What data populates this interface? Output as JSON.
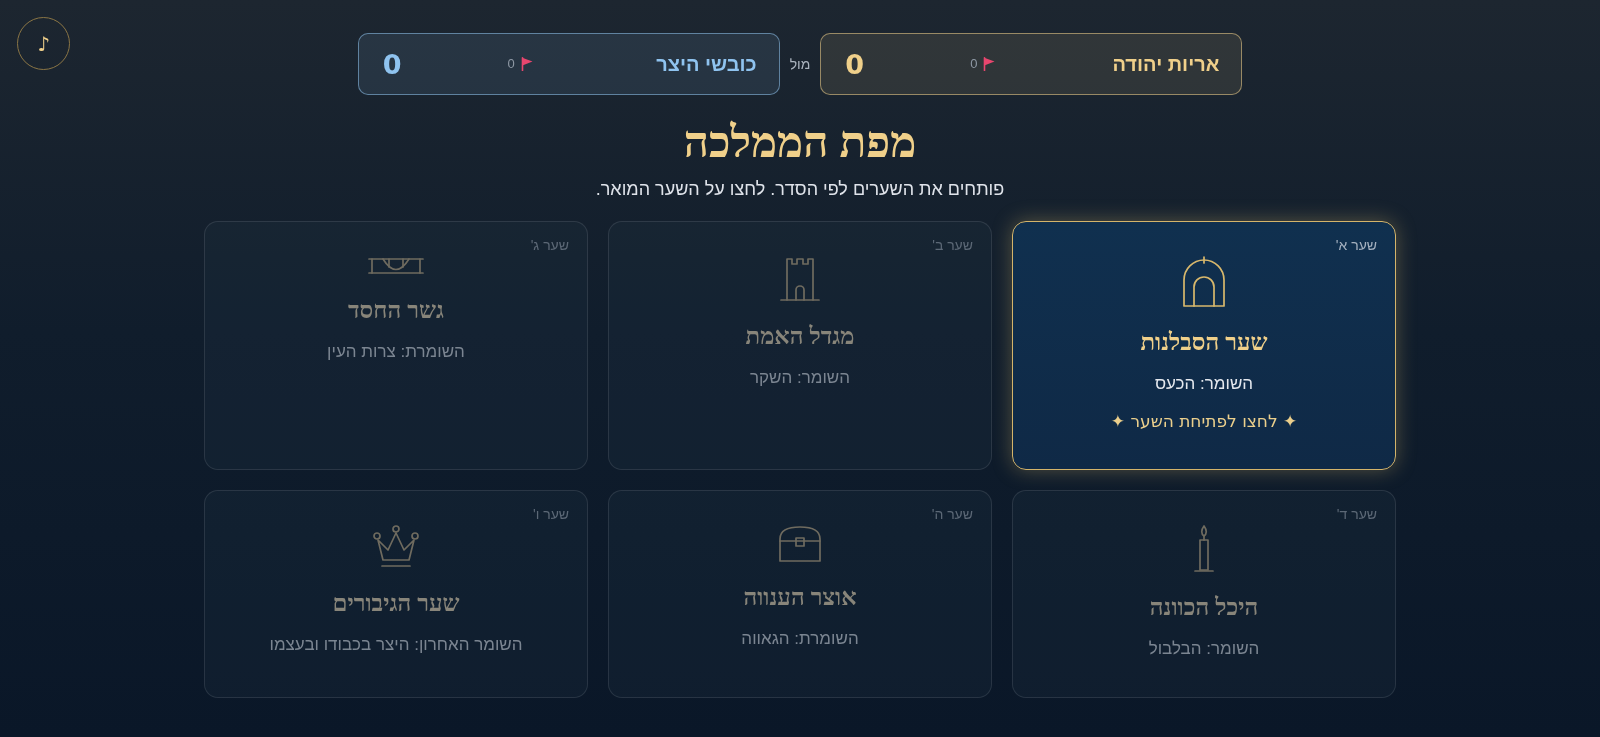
{
  "music_button": {
    "label": "♪"
  },
  "scoreboard": {
    "teams": [
      {
        "name": "אריות יהודה",
        "flags": "0",
        "score": "0",
        "color": "#f0d08a"
      },
      {
        "name": "כובשי היצר",
        "flags": "0",
        "score": "0",
        "color": "#8fc3ef"
      }
    ],
    "versus": "מול"
  },
  "title": "מפת הממלכה",
  "subtitle": "פותחים את השערים לפי הסדר. לחצו על השער המואר.",
  "gates": [
    {
      "number": "שער א'",
      "kind": "arch",
      "name": "שער הסבלנות",
      "guardian": "השומר: הכעס",
      "hint": "✦ לחצו לפתיחת השער ✦",
      "locked": false
    },
    {
      "number": "שער ב'",
      "kind": "tower",
      "name": "מגדל האמת",
      "guardian": "השומר: השקר",
      "locked": true
    },
    {
      "number": "שער ג'",
      "kind": "bridge",
      "name": "גשר החסד",
      "guardian": "השומרת: צרות העין",
      "locked": true
    },
    {
      "number": "שער ד'",
      "kind": "candle",
      "name": "היכל הכוונה",
      "guardian": "השומר: הבלבול",
      "locked": true
    },
    {
      "number": "שער ה'",
      "kind": "chest",
      "name": "אוצר הענווה",
      "guardian": "השומרת: הגאווה",
      "locked": true
    },
    {
      "number": "שער ו'",
      "kind": "crown",
      "name": "שער הגיבורים",
      "guardian": "השומר האחרון: היצר בכבודו ובעצמו",
      "locked": true
    }
  ]
}
